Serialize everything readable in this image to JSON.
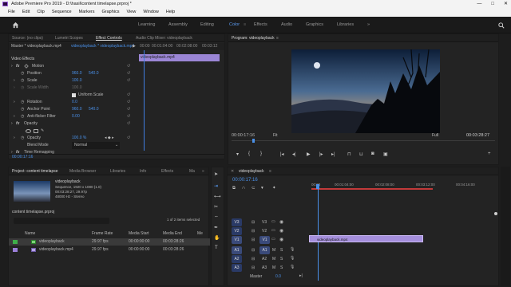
{
  "title": "Adobe Premiere Pro 2019 - D:\\hasil\\content timelapse.prproj *",
  "window_buttons": [
    "—",
    "□",
    "✕"
  ],
  "menu": [
    "File",
    "Edit",
    "Clip",
    "Sequence",
    "Markers",
    "Graphics",
    "View",
    "Window",
    "Help"
  ],
  "workspaces": [
    "Learning",
    "Assembly",
    "Editing",
    "Color",
    "Effects",
    "Audio",
    "Graphics",
    "Libraries"
  ],
  "active_workspace": "Color",
  "source_tabs": [
    "Source: (no clips)",
    "Lumetri Scopes",
    "Effect Controls",
    "Audio Clip Mixer: videoplayback"
  ],
  "effect_controls": {
    "master": "Master * videoplayback.mp4",
    "clip": "videoplayback * videoplayback.mp4",
    "ruler": [
      "00:00",
      "00:01:04:00",
      "00:02:08:00",
      "00:03:12"
    ],
    "clip_bar": "videoplayback.mp4",
    "section_video": "Video Effects",
    "motion": "Motion",
    "position_label": "Position",
    "position_x": "960.0",
    "position_y": "540.0",
    "scale_label": "Scale",
    "scale_val": "100.0",
    "scale_width_label": "Scale Width",
    "scale_width_val": "100.0",
    "uniform_label": "Uniform Scale",
    "rotation_label": "Rotation",
    "rotation_val": "0.0",
    "anchor_label": "Anchor Point",
    "anchor_x": "960.0",
    "anchor_y": "540.0",
    "flicker_label": "Anti-flicker Filter",
    "flicker_val": "0.00",
    "opacity_section": "Opacity",
    "opacity_label": "Opacity",
    "opacity_val": "100.0 %",
    "blend_label": "Blend Mode",
    "blend_val": "Normal",
    "remap": "Time Remapping",
    "timecode": "00:00:17:16"
  },
  "program": {
    "tab": "Program: videoplayback",
    "timecode": "00:00:17:16",
    "fit": "Fit",
    "quality": "Full",
    "duration": "00:03:28:27"
  },
  "project": {
    "tabs": [
      "Project: content timelapse",
      "Media Browser",
      "Libraries",
      "Info",
      "Effects",
      "Ma"
    ],
    "seq_name": "videoplayback",
    "seq_info_1": "Sequence, 1920 x 1080 (1.0)",
    "seq_info_2": "00:03:28:27, 29.97p",
    "seq_info_3": "48000 Hz - Stereo",
    "file_name": "content timelapse.prproj",
    "selection": "1 of 2 items selected",
    "columns": [
      "Name",
      "Frame Rate",
      "Media Start",
      "Media End",
      "Me"
    ],
    "rows": [
      {
        "name": "videoplayback",
        "fps": "29.97 fps",
        "start": "00:00:00:00",
        "end": "00:03:28:26",
        "color": "#3fae4a"
      },
      {
        "name": "videoplayback.mp4",
        "fps": "29.97 fps",
        "start": "00:00:00:00",
        "end": "00:03:28:26",
        "color": "#9b7fd9"
      }
    ]
  },
  "timeline": {
    "tab": "videoplayback",
    "timecode": "00:00:17:16",
    "ruler": [
      "00:00",
      "00:01:04:00",
      "00:02:08:00",
      "00:03:12:00",
      "00:04:16:00"
    ],
    "video_tracks": [
      "V3",
      "V2",
      "V1"
    ],
    "audio_tracks": [
      "A1",
      "A2",
      "A3"
    ],
    "master_label": "Master",
    "master_val": "0.0",
    "clip_label": "videoplayback.mp4"
  }
}
